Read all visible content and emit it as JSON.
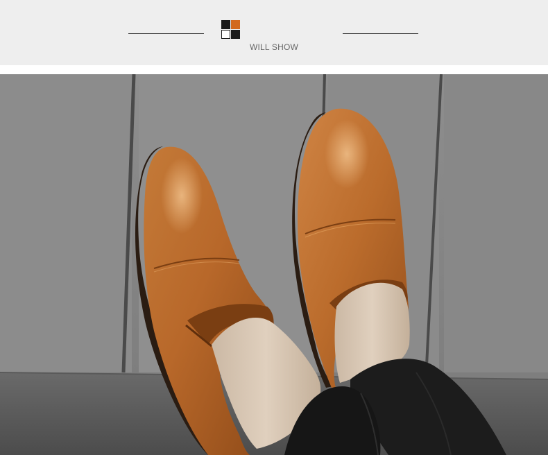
{
  "banner": {
    "caption": "WILL SHOW",
    "background": "#eeeeee",
    "rule_color": "#333333",
    "logo_colors": {
      "top_left": "#1a1a1a",
      "top_right": "#d2691e",
      "bottom_left": "#ffffff",
      "bottom_right": "#1a1a1a"
    }
  },
  "photo": {
    "subject": "brown-leather-slip-on-shoes",
    "colors": {
      "wall": "#8a8a8a",
      "leather": "#b8682a",
      "leather_highlight": "#d08a48",
      "sole": "#2a1c12",
      "trousers": "#1c1c1c",
      "skin": "#d8c7b4"
    }
  }
}
